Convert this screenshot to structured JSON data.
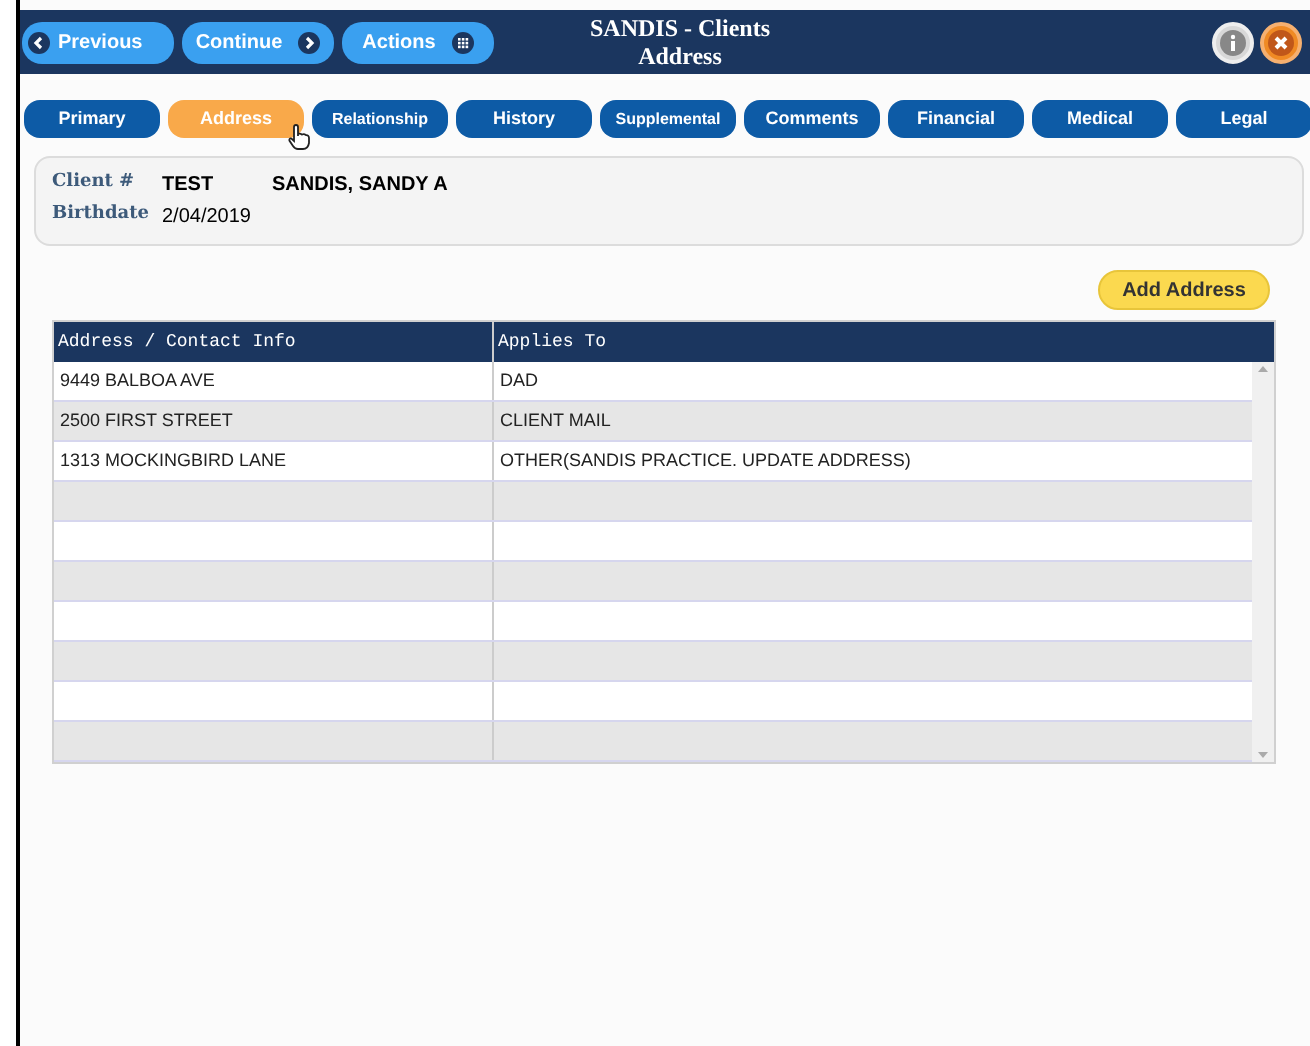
{
  "header": {
    "buttons": [
      {
        "label": "Previous",
        "kind": "back"
      },
      {
        "label": "Continue",
        "kind": "forward"
      },
      {
        "label": "Actions",
        "kind": "menu"
      }
    ],
    "title": "SANDIS - Clients",
    "subtitle": "Address"
  },
  "tabs": [
    {
      "label": "Primary",
      "selected": false
    },
    {
      "label": "Address",
      "selected": true
    },
    {
      "label": "Relationship",
      "selected": false
    },
    {
      "label": "History",
      "selected": false
    },
    {
      "label": "Supplemental",
      "selected": false
    },
    {
      "label": "Comments",
      "selected": false
    },
    {
      "label": "Financial",
      "selected": false
    },
    {
      "label": "Medical",
      "selected": false
    },
    {
      "label": "Legal",
      "selected": false
    }
  ],
  "client": {
    "number_label": "Client #",
    "number": "TEST",
    "name": "SANDIS, SANDY A",
    "birthdate_label": "Birthdate",
    "birthdate": "2/04/2019"
  },
  "add_button": "Add Address",
  "table": {
    "columns": [
      "Address / Contact Info",
      "Applies To"
    ],
    "rows": [
      [
        "9449 BALBOA AVE",
        "DAD"
      ],
      [
        "2500 FIRST STREET",
        "CLIENT MAIL"
      ],
      [
        "1313 MOCKINGBIRD LANE",
        "OTHER(SANDIS PRACTICE. UPDATE ADDRESS)"
      ]
    ]
  }
}
